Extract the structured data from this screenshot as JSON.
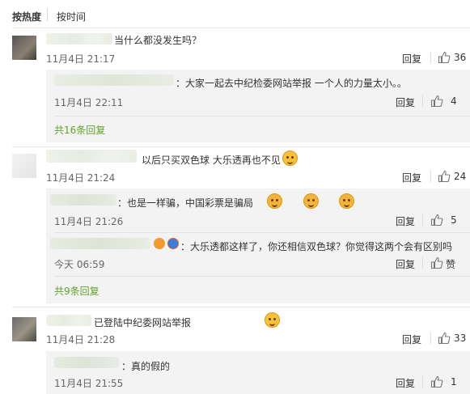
{
  "sort": {
    "hot": "按热度",
    "time": "按时间"
  },
  "common": {
    "reply": "回复",
    "like_word": "赞"
  },
  "comments": [
    {
      "text": "当什么都没发生吗？",
      "time": "11月4日 21:17",
      "likes": "36",
      "subs": [
        {
          "text": "：大家一起去中纪检委网站举报  一个人的力量太小。。",
          "time": "11月4日 22:11",
          "likes": "4"
        }
      ],
      "more": "共16条回复"
    },
    {
      "text": "以后只买双色球 大乐透再也不见",
      "time": "11月4日 21:24",
      "likes": "24",
      "subs": [
        {
          "text": "：也是一样骗，中国彩票是骗局",
          "time": "11月4日 21:26",
          "likes": "5"
        },
        {
          "text": "：大乐透都这样了，你还相信双色球？你觉得这两个会有区别吗",
          "time": "今天 06:59",
          "likes": ""
        }
      ],
      "more": "共9条回复"
    },
    {
      "text": "已登陆中纪委网站举报",
      "time": "11月4日 21:28",
      "likes": "33",
      "subs": [
        {
          "text": "：真的假的",
          "time": "11月4日 21:55",
          "likes": "1"
        }
      ]
    }
  ]
}
